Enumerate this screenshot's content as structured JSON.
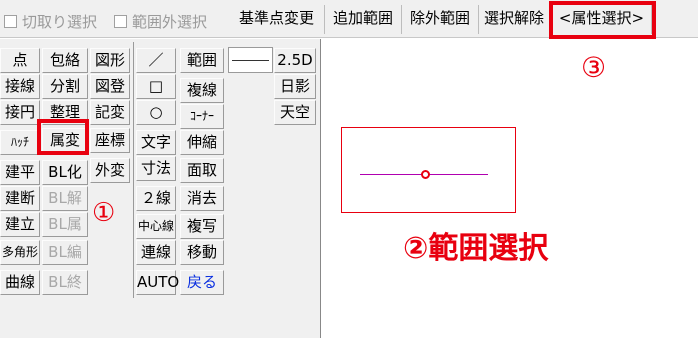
{
  "toolbar": {
    "cut_select": "切取り選択",
    "out_of_range_select": "範囲外選択",
    "base_point_change": "基準点変更",
    "add_range": "追加範囲",
    "exclude_range": "除外範囲",
    "deselect": "選択解除",
    "attribute_select": "<属性選択>"
  },
  "palette": {
    "col1": [
      "点",
      "接線",
      "接円",
      "ﾊｯﾁ",
      "建平",
      "建断",
      "建立",
      "多角形",
      "曲線"
    ],
    "col2": [
      "包絡",
      "分割",
      "整理",
      "属変",
      "BL化",
      "BL解",
      "BL属",
      "BL編",
      "BL終"
    ],
    "col3": [
      "図形",
      "図登",
      "記変",
      "座標",
      "外変"
    ],
    "col4": [
      "／",
      "□",
      "○",
      "文字",
      "寸法",
      "２線",
      "中心線",
      "連線",
      "AUTO"
    ],
    "col5": [
      "範囲",
      "複線",
      "ｺｰﾅｰ",
      "伸縮",
      "面取",
      "消去",
      "複写",
      "移動",
      "戻る"
    ],
    "col6": [
      "2.5D",
      "日影",
      "天空"
    ]
  },
  "annotations": {
    "step1": "①",
    "step2": "②範囲選択",
    "step3": "③"
  },
  "colors": {
    "highlight": "#e8000f",
    "line": "#b000b0",
    "back_button": "#0a2fe0"
  }
}
